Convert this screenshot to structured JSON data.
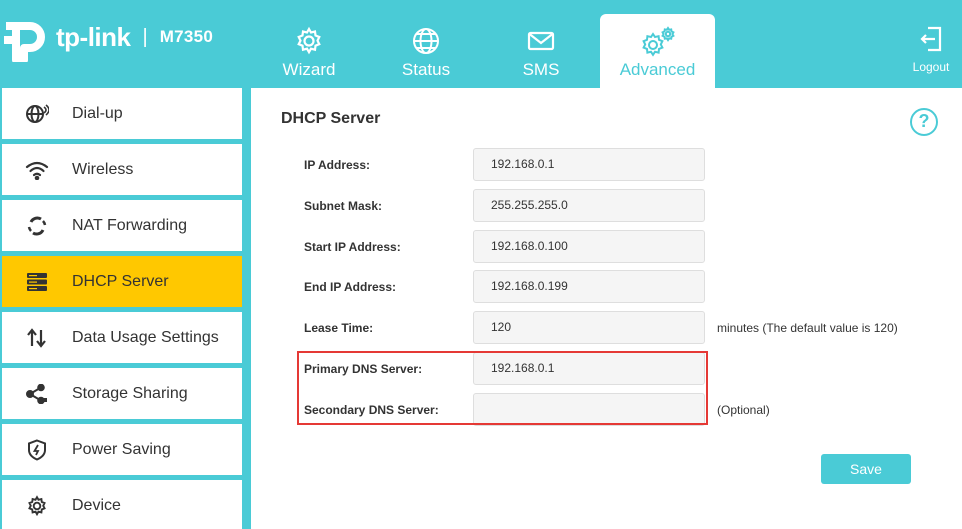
{
  "brand": {
    "name": "tp-link",
    "separator": "|",
    "model": "M7350"
  },
  "nav": {
    "tabs": [
      {
        "label": "Wizard",
        "icon": "gear-icon"
      },
      {
        "label": "Status",
        "icon": "globe-icon"
      },
      {
        "label": "SMS",
        "icon": "mail-icon"
      },
      {
        "label": "Advanced",
        "icon": "gears-icon",
        "active": true
      }
    ],
    "logout_label": "Logout"
  },
  "sidebar": {
    "items": [
      {
        "label": "Dial-up",
        "icon": "globe-phone-icon"
      },
      {
        "label": "Wireless",
        "icon": "wifi-icon"
      },
      {
        "label": "NAT Forwarding",
        "icon": "nat-icon"
      },
      {
        "label": "DHCP Server",
        "icon": "server-icon",
        "active": true
      },
      {
        "label": "Data Usage Settings",
        "icon": "up-down-arrows-icon"
      },
      {
        "label": "Storage Sharing",
        "icon": "share-icon"
      },
      {
        "label": "Power Saving",
        "icon": "shield-icon"
      },
      {
        "label": "Device",
        "icon": "gear-icon"
      }
    ]
  },
  "content": {
    "title": "DHCP Server",
    "help_symbol": "?",
    "fields": {
      "ip_address": {
        "label": "IP Address:",
        "value": "192.168.0.1"
      },
      "subnet_mask": {
        "label": "Subnet Mask:",
        "value": "255.255.255.0"
      },
      "start_ip": {
        "label": "Start IP Address:",
        "value": "192.168.0.100"
      },
      "end_ip": {
        "label": "End IP Address:",
        "value": "192.168.0.199"
      },
      "lease_time": {
        "label": "Lease Time:",
        "value": "120",
        "hint": "minutes (The default value is 120)"
      },
      "primary_dns": {
        "label": "Primary DNS Server:",
        "value": "192.168.0.1"
      },
      "secondary_dns": {
        "label": "Secondary DNS Server:",
        "value": "",
        "hint": "(Optional)"
      }
    },
    "save_label": "Save"
  },
  "colors": {
    "accent": "#4acbd6",
    "active_sidebar": "#ffc800",
    "highlight": "#e53935"
  }
}
